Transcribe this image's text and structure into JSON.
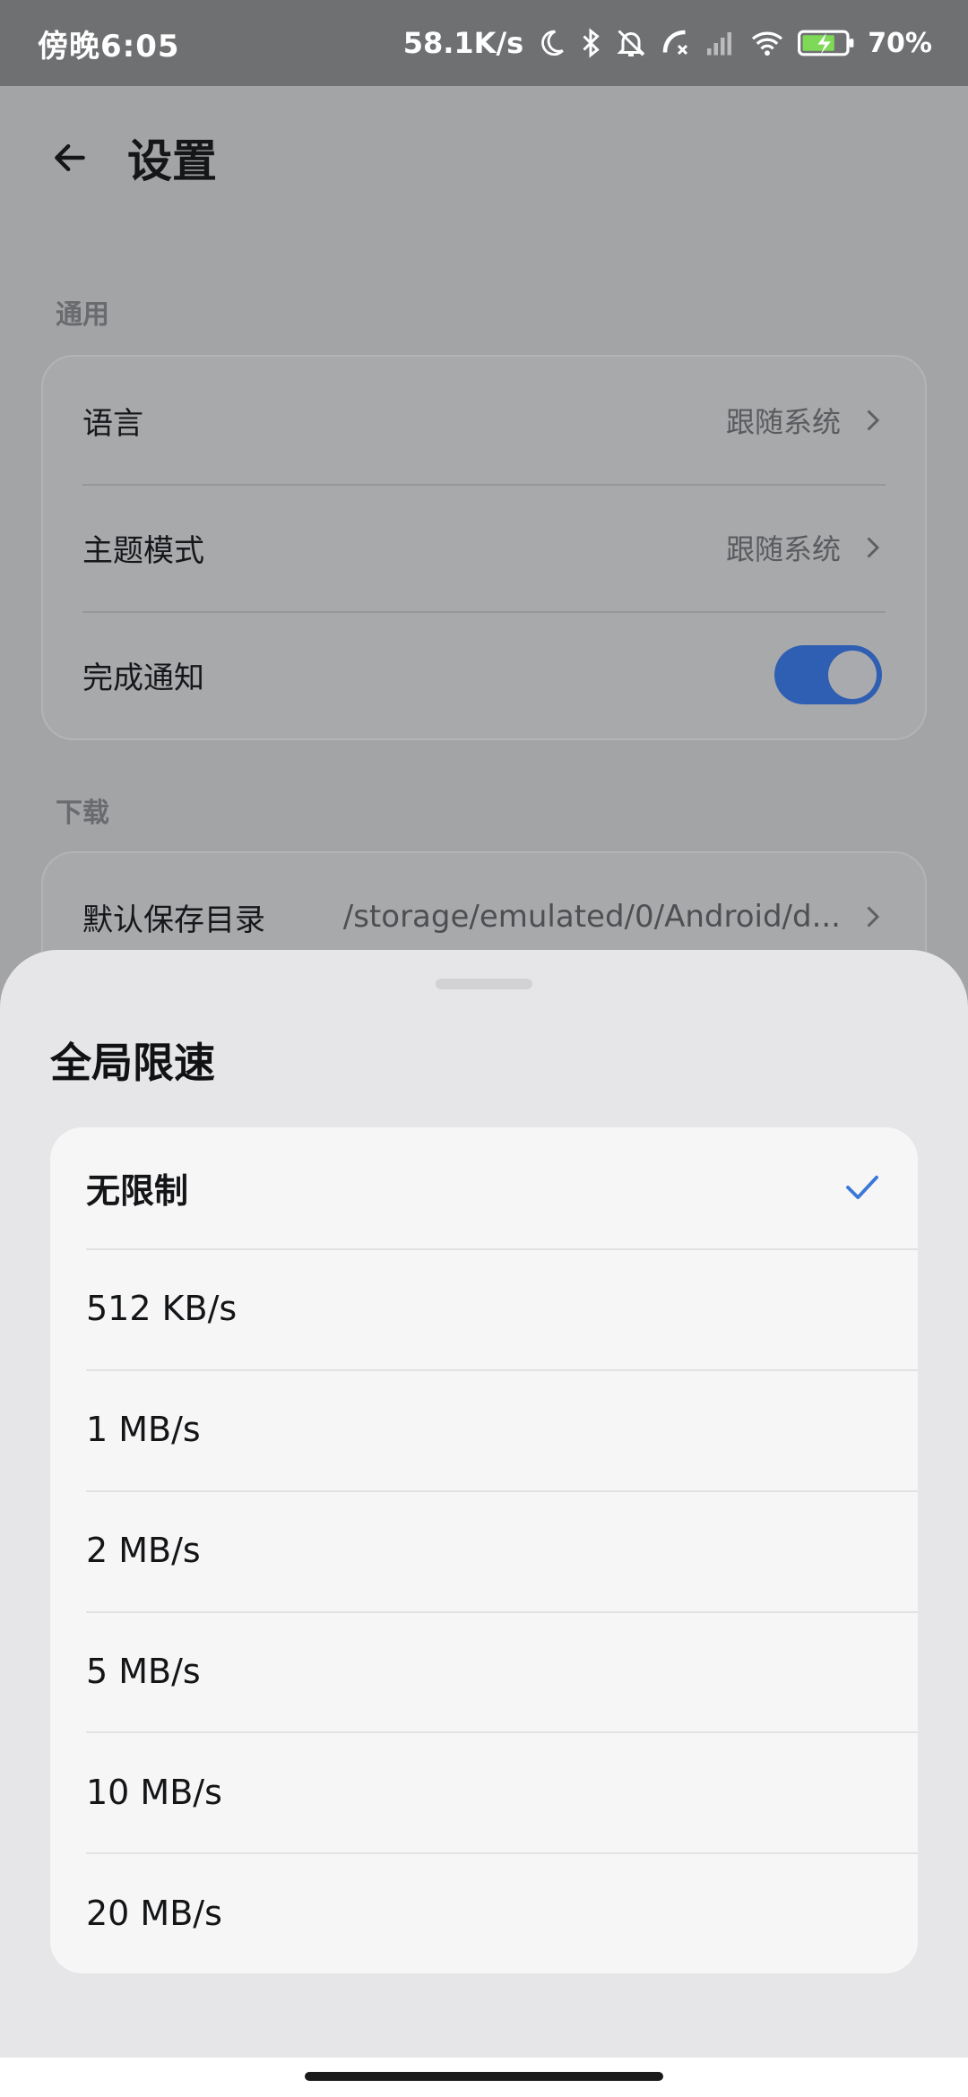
{
  "status_bar": {
    "time": "傍晚6:05",
    "net_speed": "58.1K/s",
    "battery_percent": "70%",
    "icons": [
      "moon-icon",
      "bluetooth-icon",
      "bell-off-icon",
      "call-forward-icon",
      "cellular-signal-icon",
      "wifi-icon",
      "battery-charging-icon"
    ]
  },
  "header": {
    "title": "设置"
  },
  "sections": {
    "general": {
      "label": "通用",
      "rows": {
        "language": {
          "label": "语言",
          "value": "跟随系统"
        },
        "theme": {
          "label": "主题模式",
          "value": "跟随系统"
        },
        "notify": {
          "label": "完成通知",
          "toggle_on": true
        }
      }
    },
    "download": {
      "label": "下载",
      "rows": {
        "save_dir": {
          "label": "默认保存目录",
          "value": "/storage/emulated/0/Android/d..."
        }
      }
    }
  },
  "sheet": {
    "title": "全局限速",
    "selected_index": 0,
    "options": [
      "无限制",
      "512 KB/s",
      "1 MB/s",
      "2 MB/s",
      "5 MB/s",
      "10 MB/s",
      "20 MB/s"
    ]
  },
  "colors": {
    "accent": "#2f5fb3",
    "check": "#3b78d8",
    "sheet_bg": "#e6e6e8",
    "scrim_bg": "#a3a4a6"
  }
}
